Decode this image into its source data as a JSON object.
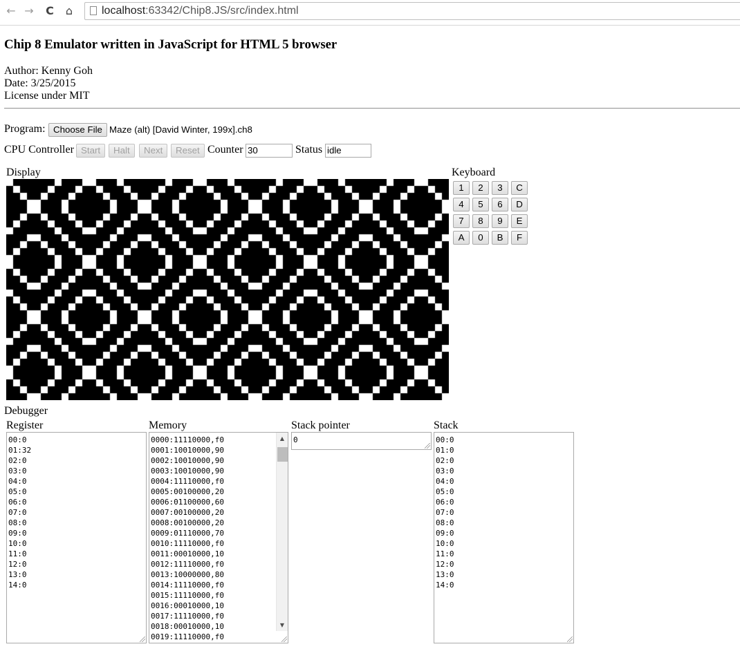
{
  "browser": {
    "back_glyph": "←",
    "forward_glyph": "→",
    "reload_glyph": "C",
    "home_glyph": "⌂",
    "url_host": "localhost",
    "url_path": ":63342/Chip8.JS/src/index.html"
  },
  "page": {
    "title": "Chip 8 Emulator written in JavaScript for HTML 5 browser",
    "author": "Author: Kenny Goh",
    "date": "Date: 3/25/2015",
    "license": "License under MIT"
  },
  "program": {
    "label": "Program:",
    "choose_file_label": "Choose File",
    "file_name": "Maze (alt) [David Winter, 199x].ch8"
  },
  "cpu": {
    "label": "CPU Controller",
    "start_label": "Start",
    "halt_label": "Halt",
    "next_label": "Next",
    "reset_label": "Reset",
    "counter_label": "Counter",
    "counter_value": "30",
    "status_label": "Status",
    "status_value": "idle"
  },
  "display": {
    "label": "Display",
    "resolution": [
      64,
      32
    ],
    "pixel_on_color": "#ffffff",
    "pixel_off_color": "#000000"
  },
  "keyboard": {
    "label": "Keyboard",
    "rows": [
      [
        "1",
        "2",
        "3",
        "C"
      ],
      [
        "4",
        "5",
        "6",
        "D"
      ],
      [
        "7",
        "8",
        "9",
        "E"
      ],
      [
        "A",
        "0",
        "B",
        "F"
      ]
    ]
  },
  "debugger": {
    "label": "Debugger",
    "register_label": "Register",
    "memory_label": "Memory",
    "stack_pointer_label": "Stack pointer",
    "stack_label": "Stack",
    "registers": [
      "00:0",
      "01:32",
      "02:0",
      "03:0",
      "04:0",
      "05:0",
      "06:0",
      "07:0",
      "08:0",
      "09:0",
      "10:0",
      "11:0",
      "12:0",
      "13:0",
      "14:0"
    ],
    "memory": [
      "0000:11110000,f0",
      "0001:10010000,90",
      "0002:10010000,90",
      "0003:10010000,90",
      "0004:11110000,f0",
      "0005:00100000,20",
      "0006:01100000,60",
      "0007:00100000,20",
      "0008:00100000,20",
      "0009:01110000,70",
      "0010:11110000,f0",
      "0011:00010000,10",
      "0012:11110000,f0",
      "0013:10000000,80",
      "0014:11110000,f0",
      "0015:11110000,f0",
      "0016:00010000,10",
      "0017:11110000,f0",
      "0018:00010000,10",
      "0019:11110000,f0"
    ],
    "stack_pointer": "0",
    "stack": [
      "00:0",
      "01:0",
      "02:0",
      "03:0",
      "04:0",
      "05:0",
      "06:0",
      "07:0",
      "08:0",
      "09:0",
      "10:0",
      "11:0",
      "12:0",
      "13:0",
      "14:0"
    ]
  }
}
